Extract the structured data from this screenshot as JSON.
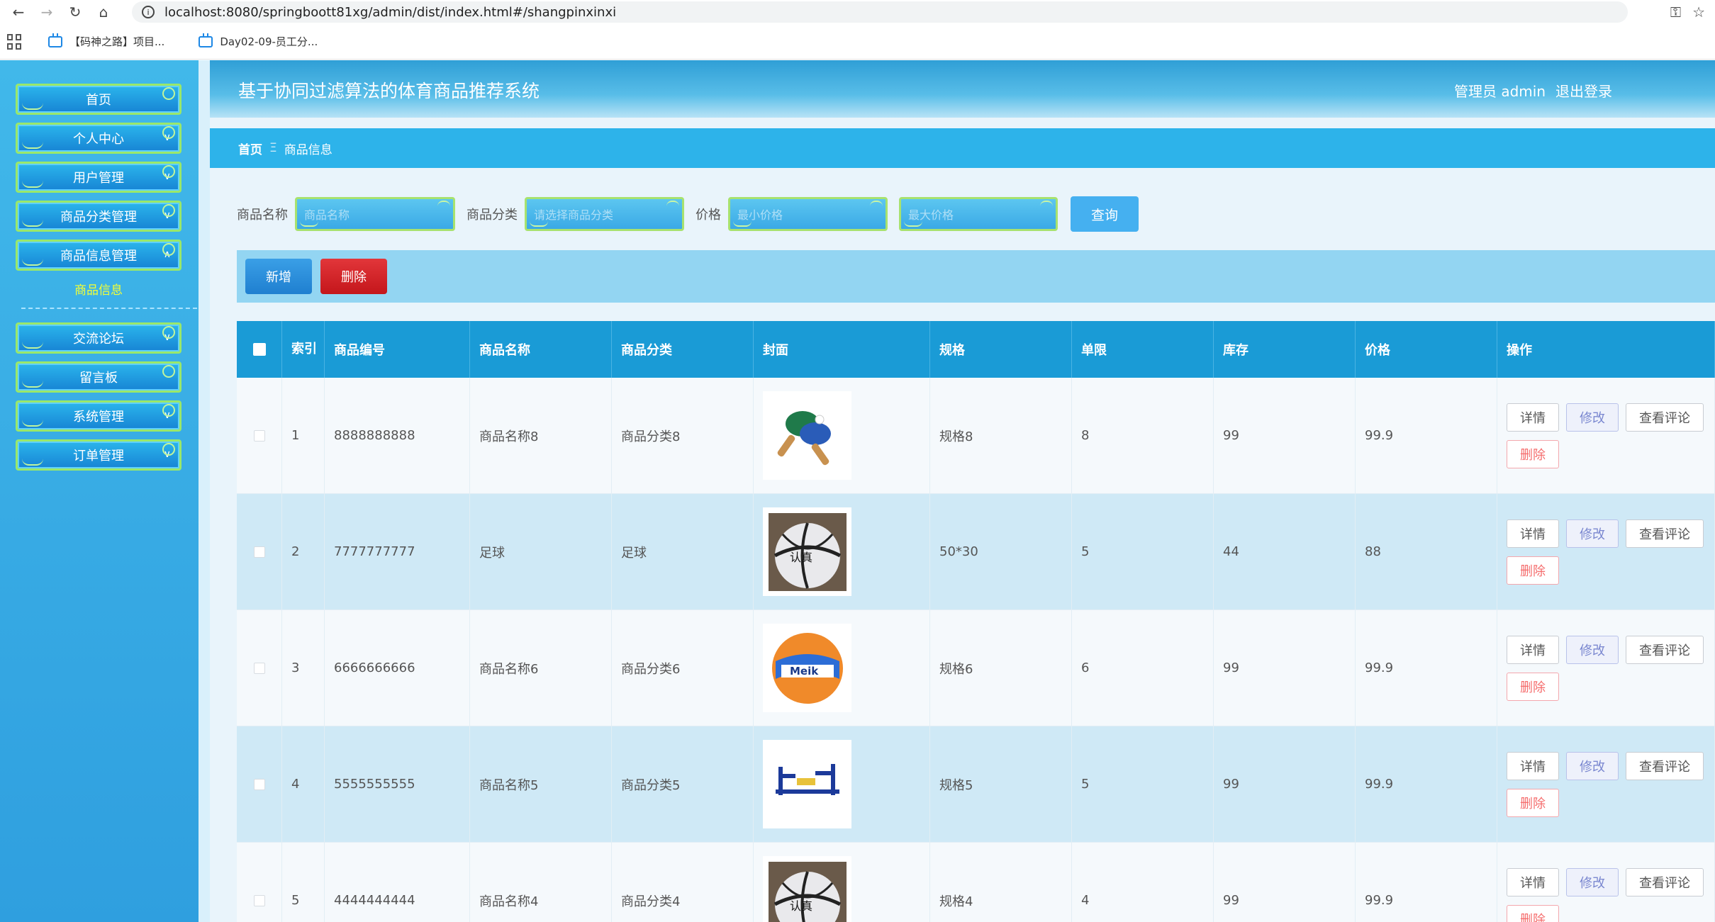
{
  "browser": {
    "url": "localhost:8080/springboott81xg/admin/dist/index.html#/shangpinxinxi",
    "bookmarks": [
      "【码神之路】项目...",
      "Day02-09-员工分..."
    ]
  },
  "sidebar": {
    "items": [
      {
        "label": "首页"
      },
      {
        "label": "个人中心"
      },
      {
        "label": "用户管理"
      },
      {
        "label": "商品分类管理"
      },
      {
        "label": "商品信息管理"
      },
      {
        "label": "交流论坛"
      },
      {
        "label": "留言板"
      },
      {
        "label": "系统管理"
      },
      {
        "label": "订单管理"
      }
    ],
    "active_sub": "商品信息"
  },
  "header": {
    "title": "基于协同过滤算法的体育商品推荐系统",
    "user": "管理员 admin",
    "logout": "退出登录"
  },
  "breadcrumb": {
    "home": "首页",
    "sep": "Ξ",
    "current": "商品信息"
  },
  "search": {
    "name_label": "商品名称",
    "name_placeholder": "商品名称",
    "category_label": "商品分类",
    "category_placeholder": "请选择商品分类",
    "price_label": "价格",
    "price_min_placeholder": "最小价格",
    "price_max_placeholder": "最大价格",
    "query_button": "查询"
  },
  "actions": {
    "add": "新增",
    "delete": "删除"
  },
  "table": {
    "headers": {
      "index": "索引",
      "code": "商品编号",
      "name": "商品名称",
      "category": "商品分类",
      "cover": "封面",
      "spec": "规格",
      "limit": "单限",
      "stock": "库存",
      "price": "价格",
      "ops": "操作"
    },
    "op_labels": {
      "detail": "详情",
      "edit": "修改",
      "review": "查看评论",
      "delete": "删除"
    },
    "rows": [
      {
        "index": "1",
        "code": "8888888888",
        "name": "商品名称8",
        "category": "商品分类8",
        "cover": "ping-pong-paddles",
        "spec": "规格8",
        "limit": "8",
        "stock": "99",
        "price": "99.9"
      },
      {
        "index": "2",
        "code": "7777777777",
        "name": "足球",
        "category": "足球",
        "cover": "basketball",
        "spec": "50*30",
        "limit": "5",
        "stock": "44",
        "price": "88"
      },
      {
        "index": "3",
        "code": "6666666666",
        "name": "商品名称6",
        "category": "商品分类6",
        "cover": "volleyball",
        "spec": "规格6",
        "limit": "6",
        "stock": "99",
        "price": "99.9"
      },
      {
        "index": "4",
        "code": "5555555555",
        "name": "商品名称5",
        "category": "商品分类5",
        "cover": "fitness-equipment",
        "spec": "规格5",
        "limit": "5",
        "stock": "99",
        "price": "99.9"
      },
      {
        "index": "5",
        "code": "4444444444",
        "name": "商品名称4",
        "category": "商品分类4",
        "cover": "basketball",
        "spec": "规格4",
        "limit": "4",
        "stock": "99",
        "price": "99.9"
      }
    ]
  },
  "colors": {
    "sidebar": "#2f9fdf",
    "header": "#2f9fd6",
    "table_header": "#1a9bd6",
    "add_button": "#1f7fd0",
    "delete_button": "#c4161b",
    "active_sub": "#f3ff35"
  }
}
